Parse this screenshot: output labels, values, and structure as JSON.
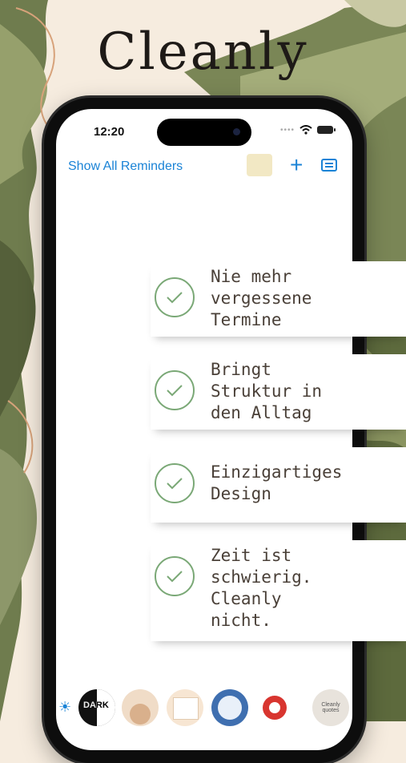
{
  "brand": {
    "title": "Cleanly"
  },
  "status": {
    "time": "12:20"
  },
  "toolbar": {
    "show_all_label": "Show All Reminders",
    "add_icon": "plus-icon",
    "list_icon": "list-icon",
    "accent": "#1a83d6"
  },
  "features": [
    {
      "text": "Nie mehr\nvergessene\nTermine"
    },
    {
      "text": "Bringt\nStruktur in\nden Alltag"
    },
    {
      "text": "Einzigartiges\nDesign"
    },
    {
      "text": "Zeit ist\nschwierig.\nCleanly\nnicht."
    }
  ],
  "dock": {
    "items": [
      {
        "label": "DARK"
      },
      {
        "label": ""
      },
      {
        "label": ""
      },
      {
        "label": ""
      },
      {
        "label": ""
      },
      {
        "label": "Cleanly quotes"
      }
    ]
  },
  "colors": {
    "check": "#7aa876",
    "background": "#f6ecdf",
    "olive": "#6f7c4e"
  }
}
